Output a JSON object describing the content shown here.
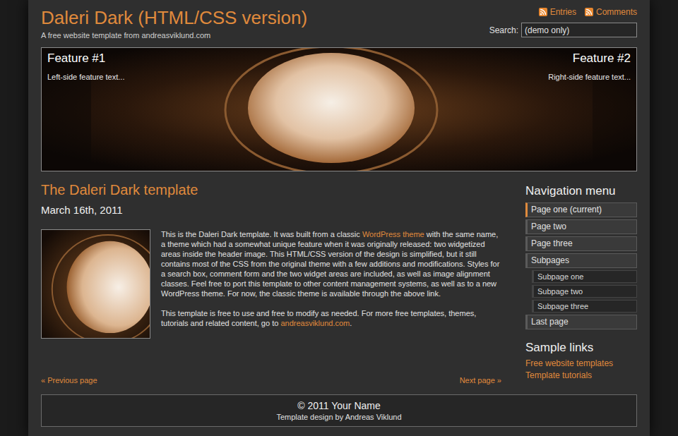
{
  "site": {
    "title": "Daleri Dark (HTML/CSS version)",
    "tagline": "A free website template from andreasviklund.com"
  },
  "feeds": [
    {
      "label": "Entries"
    },
    {
      "label": "Comments"
    }
  ],
  "search": {
    "label": "Search:",
    "value": "(demo only)"
  },
  "features": [
    {
      "title": "Feature #1",
      "text": "Left-side feature text..."
    },
    {
      "title": "Feature #2",
      "text": "Right-side feature text..."
    }
  ],
  "post": {
    "title": "The Daleri Dark template",
    "date": "March 16th, 2011",
    "paragraphs": [
      [
        {
          "text": "This is the Daleri Dark template. It was built from a classic ",
          "link": false
        },
        {
          "text": "WordPress theme",
          "link": true
        },
        {
          "text": " with the same name, a theme which had a somewhat unique feature when it was originally released: two widgetized areas inside the header image. This HTML/CSS version of the design is simplified, but it still contains most of the CSS from the original theme with a few additions and modifications. Styles for a search box, comment form and the two widget areas are included, as well as image alignment classes. Feel free to port this template to other content management systems, as well as to a new WordPress theme. For now, the classic theme is available through the above link.",
          "link": false
        }
      ],
      [
        {
          "text": "This template is free to use and free to modify as needed. For more free templates, themes, tutorials and related content, go to ",
          "link": false
        },
        {
          "text": "andreasviklund.com",
          "link": true
        },
        {
          "text": ".",
          "link": false
        }
      ]
    ]
  },
  "pager": {
    "previous": "« Previous page",
    "next": "Next page »"
  },
  "nav": {
    "heading": "Navigation menu",
    "items": [
      {
        "label": "Page one (current)",
        "selected": true,
        "kind": "page"
      },
      {
        "label": "Page two",
        "selected": false,
        "kind": "page"
      },
      {
        "label": "Page three",
        "selected": false,
        "kind": "page"
      },
      {
        "label": "Subpages",
        "selected": false,
        "kind": "page"
      },
      {
        "label": "Subpage one",
        "selected": false,
        "kind": "subpage"
      },
      {
        "label": "Subpage two",
        "selected": false,
        "kind": "subpage"
      },
      {
        "label": "Subpage three",
        "selected": false,
        "kind": "subpage"
      },
      {
        "label": "Last page",
        "selected": false,
        "kind": "page"
      }
    ]
  },
  "links": {
    "heading": "Sample links",
    "items": [
      "Free website templates",
      "Template tutorials"
    ]
  },
  "footer": {
    "copyright": "© 2011 Your Name",
    "credit": "Template design by Andreas Viklund"
  }
}
